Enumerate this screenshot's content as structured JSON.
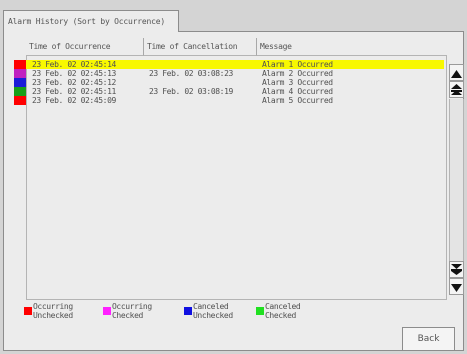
{
  "tab": {
    "label": "Alarm History (Sort by Occurrence)"
  },
  "columns": {
    "occurrence": "Time of Occurrence",
    "cancellation": "Time of Cancellation",
    "message": "Message"
  },
  "rows": [
    {
      "status": "occurring-unchecked",
      "color": "#ff0000",
      "occurrence": "23 Feb. 02 02:45:14",
      "cancellation": "",
      "message": "Alarm 1 Occurred",
      "selected": true
    },
    {
      "status": "occurring-checked",
      "color": "#c020c0",
      "occurrence": "23 Feb. 02 02:45:13",
      "cancellation": "23 Feb. 02 03:08:23",
      "message": "Alarm 2 Occurred",
      "selected": false
    },
    {
      "status": "canceled-unchecked",
      "color": "#1c1cd8",
      "occurrence": "23 Feb. 02 02:45:12",
      "cancellation": "",
      "message": "Alarm 3 Occurred",
      "selected": false
    },
    {
      "status": "canceled-checked",
      "color": "#18a018",
      "occurrence": "23 Feb. 02 02:45:11",
      "cancellation": "23 Feb. 02 03:08:19",
      "message": "Alarm 4 Occurred",
      "selected": false
    },
    {
      "status": "occurring-unchecked",
      "color": "#ff0000",
      "occurrence": "23 Feb. 02 02:45:09",
      "cancellation": "",
      "message": "Alarm 5 Occurred",
      "selected": false
    }
  ],
  "legend": [
    {
      "line1": "Occurring",
      "line2": "Unchecked",
      "color": "#ff0000"
    },
    {
      "line1": "Occurring",
      "line2": "Checked",
      "color": "#ff20ff"
    },
    {
      "line1": "Canceled",
      "line2": "Unchecked",
      "color": "#1010e0"
    },
    {
      "line1": "Canceled",
      "line2": "Checked",
      "color": "#20e020"
    }
  ],
  "buttons": {
    "back": "Back"
  },
  "icons": {
    "scroll_up": "up-icon",
    "page_up": "page-up-icon",
    "page_down": "page-down-icon",
    "scroll_down": "down-icon"
  }
}
